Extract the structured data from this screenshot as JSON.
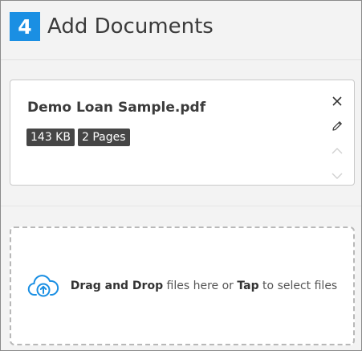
{
  "header": {
    "step_number": "4",
    "title": "Add Documents"
  },
  "file": {
    "name": "Demo Loan Sample.pdf",
    "size": "143 KB",
    "pages": "2 Pages"
  },
  "dropzone": {
    "strong1": "Drag and Drop",
    "text1": " files here or ",
    "strong2": "Tap",
    "text2": " to select files"
  },
  "colors": {
    "accent": "#1a8fe3",
    "badge_bg": "#454545",
    "text": "#3b3b3b"
  },
  "icons": {
    "remove": "close-icon",
    "rename": "pencil-icon",
    "move_up": "chevron-up-icon",
    "move_down": "chevron-down-icon",
    "upload": "cloud-upload-icon"
  }
}
